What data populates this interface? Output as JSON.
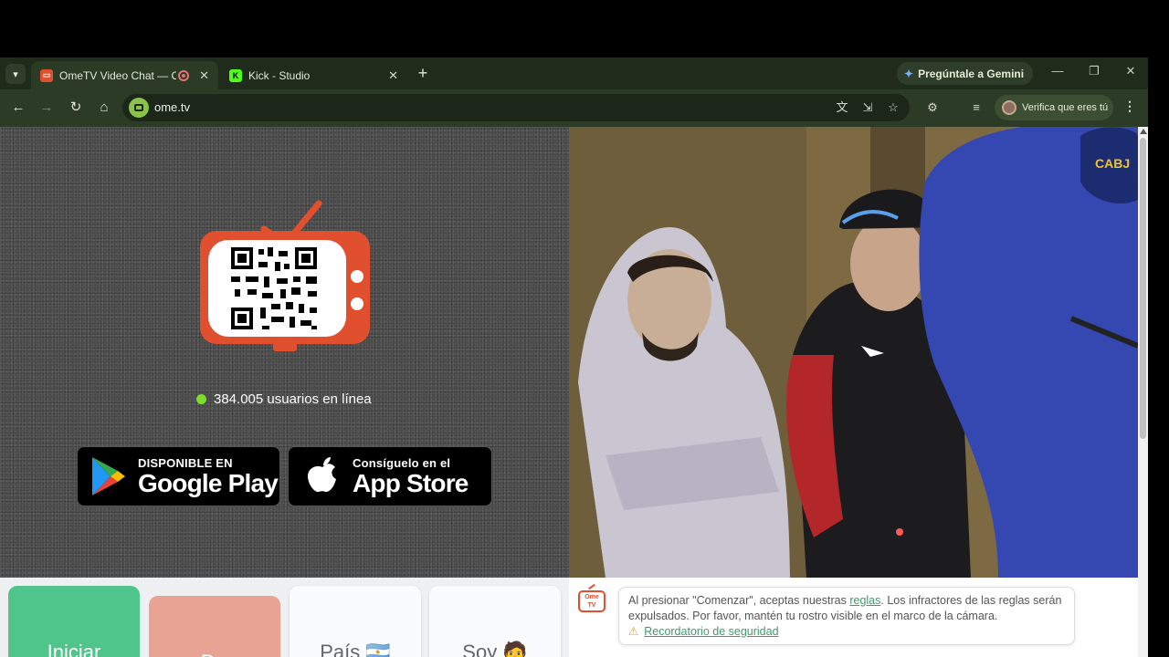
{
  "browser": {
    "tabs": [
      {
        "title": "OmeTV Video Chat — Ome",
        "active": true
      },
      {
        "title": "Kick - Studio",
        "active": false
      }
    ],
    "tab_close_glyph": "✕",
    "new_tab_glyph": "+",
    "gemini_label": "Pregúntale a Gemini",
    "url": "ome.tv",
    "verify_label": "Verifica que eres tú",
    "accent": "#2b3b26"
  },
  "page": {
    "online_count": "384.005 usuarios en línea",
    "google_play": {
      "small": "DISPONIBLE EN",
      "big": "Google Play"
    },
    "app_store": {
      "small": "Consíguelo en el",
      "big": "App Store"
    },
    "buttons": {
      "start": "Iniciar",
      "next": "P...",
      "country": "País 🇦🇷",
      "gender": "Soy 🧑"
    },
    "rules": {
      "logo_text": "Ome TV",
      "text_before": "Al presionar \"Comenzar\", aceptas nuestras ",
      "link": "reglas",
      "text_after": ". Los infractores de las reglas serán expulsados. Por favor, mantén tu rostro visible en el marco de la cámara.",
      "safety_link": "Recordatorio de seguridad"
    },
    "colors": {
      "online_dot": "#7cdd2f",
      "start_button": "#4fc48b",
      "next_button": "#e9a392",
      "logo": "#e0502e"
    }
  }
}
